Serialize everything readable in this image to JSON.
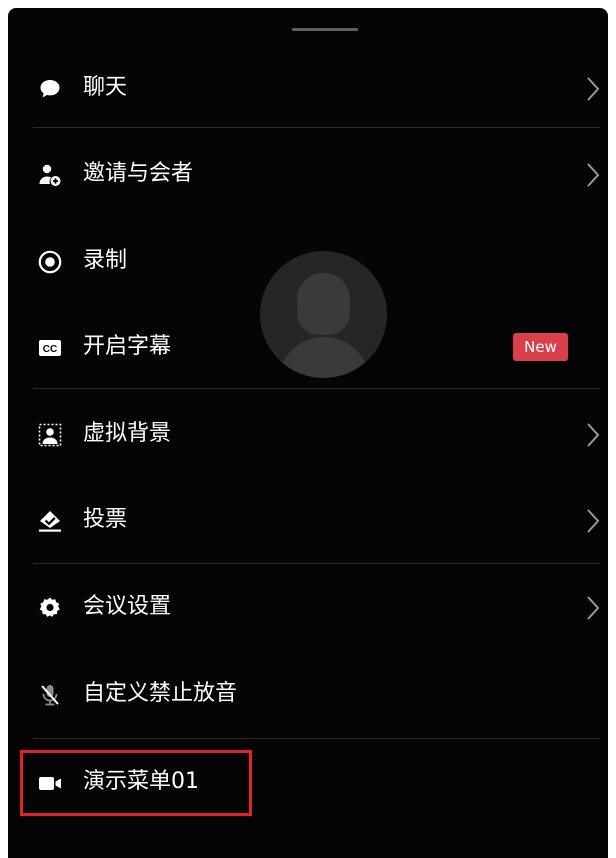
{
  "menu": {
    "items": [
      {
        "label": "聊天",
        "icon": "chat-bubble-icon",
        "has_chevron": true
      },
      {
        "label": "邀请与会者",
        "icon": "add-participant-icon",
        "has_chevron": true
      },
      {
        "label": "录制",
        "icon": "record-icon",
        "has_chevron": false
      },
      {
        "label": "开启字幕",
        "icon": "closed-caption-icon",
        "has_chevron": false,
        "badge": "New"
      },
      {
        "label": "虚拟背景",
        "icon": "virtual-background-icon",
        "has_chevron": true
      },
      {
        "label": "投票",
        "icon": "vote-icon",
        "has_chevron": true
      },
      {
        "label": "会议设置",
        "icon": "gear-icon",
        "has_chevron": true
      },
      {
        "label": "自定义禁止放音",
        "icon": "mic-off-icon",
        "has_chevron": false
      },
      {
        "label": "演示菜单01",
        "icon": "video-camera-icon",
        "has_chevron": false,
        "highlighted": true
      }
    ]
  },
  "avatar": {
    "icon": "user-avatar-icon"
  },
  "colors": {
    "background": "#050505",
    "text": "#ffffff",
    "divider": "#2b2b2b",
    "chevron": "#9a9a9a",
    "badge": "#d9404c",
    "highlight_border": "#e02424"
  }
}
